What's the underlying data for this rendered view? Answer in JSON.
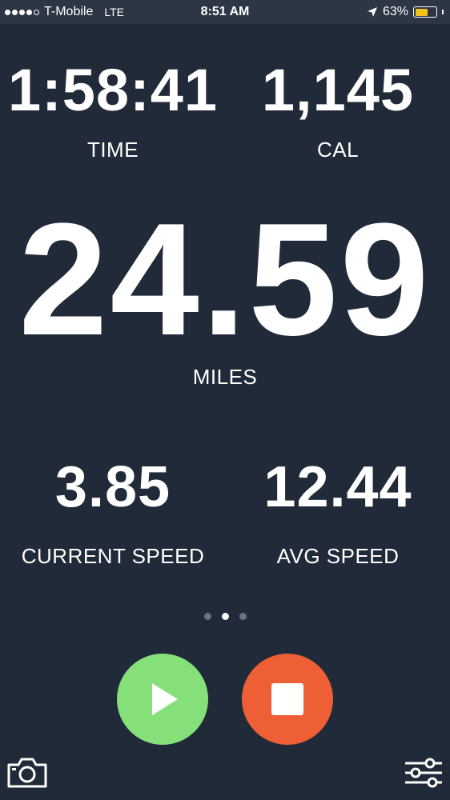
{
  "status_bar": {
    "carrier": "T-Mobile",
    "network": "LTE",
    "time": "8:51 AM",
    "battery_percent": "63%",
    "battery_level": 0.63,
    "signal_bars_filled": 4,
    "signal_bars_total": 5,
    "battery_color": "#f2c21b"
  },
  "stats": {
    "time": {
      "value": "1:58:41",
      "label": "TIME"
    },
    "calories": {
      "value": "1,145",
      "label": "CAL"
    },
    "distance": {
      "value": "24.59",
      "label": "MILES"
    },
    "current_speed": {
      "value": "3.85",
      "label": "CURRENT SPEED"
    },
    "avg_speed": {
      "value": "12.44",
      "label": "AVG SPEED"
    }
  },
  "pager": {
    "count": 3,
    "active_index": 1
  },
  "controls": {
    "play_icon": "play-icon",
    "stop_icon": "stop-icon",
    "camera_icon": "camera-icon",
    "settings_icon": "sliders-icon",
    "play_color": "#86e07a",
    "stop_color": "#ef5f35"
  },
  "theme": {
    "background": "#202a38",
    "status_bar_background": "#2c3644"
  }
}
